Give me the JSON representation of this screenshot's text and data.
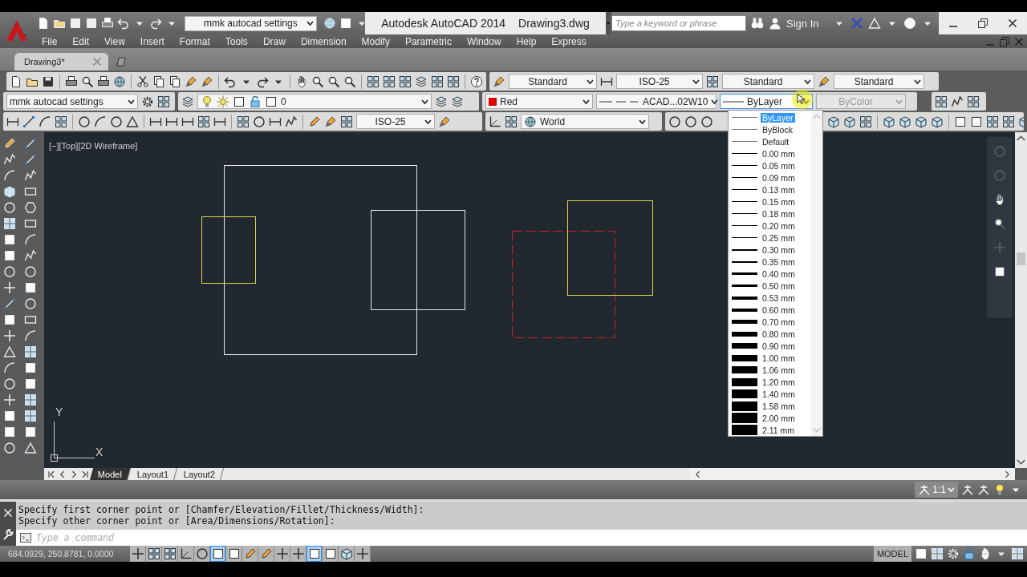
{
  "title_bar": {
    "workspace": "mmk autocad settings",
    "title": "Autodesk AutoCAD 2014",
    "document": "Drawing3.dwg",
    "search": {
      "placeholder": "Type a keyword or phrase"
    },
    "sign_in": "Sign In"
  },
  "menu": [
    "File",
    "Edit",
    "View",
    "Insert",
    "Format",
    "Tools",
    "Draw",
    "Dimension",
    "Modify",
    "Parametric",
    "Window",
    "Help",
    "Express"
  ],
  "document_tabs": [
    {
      "label": "Drawing3*",
      "selected": true
    }
  ],
  "styles_toolbar": {
    "text_style": "Standard",
    "dimension_style": "ISO-25",
    "table_style": "Standard",
    "multileader_style": "Standard"
  },
  "workspaces_toolbar": {
    "workspace": "mmk autocad settings"
  },
  "layers_toolbar": {
    "layer": "0"
  },
  "properties_toolbar": {
    "color": {
      "label": "Red",
      "color": "#e00000"
    },
    "linetype": "ACAD...02W10",
    "lineweight": {
      "label": "ByLayer",
      "expanded": true
    },
    "plot_style": {
      "label": "ByColor",
      "disabled": true
    }
  },
  "dimension_toolbar": {
    "dimension_style": "ISO-25"
  },
  "ucs_toolbar": {
    "ucs": "World"
  },
  "lineweight_list": [
    {
      "label": "ByLayer",
      "selected": true
    },
    {
      "label": "ByBlock",
      "selected": false
    },
    {
      "label": "Default",
      "selected": false
    },
    {
      "label": "0.00 mm",
      "selected": false
    },
    {
      "label": "0.05 mm",
      "selected": false
    },
    {
      "label": "0.09 mm",
      "selected": false
    },
    {
      "label": "0.13 mm",
      "selected": false
    },
    {
      "label": "0.15 mm",
      "selected": false
    },
    {
      "label": "0.18 mm",
      "selected": false
    },
    {
      "label": "0.20 mm",
      "selected": false
    },
    {
      "label": "0.25 mm",
      "selected": false
    },
    {
      "label": "0.30 mm",
      "selected": false
    },
    {
      "label": "0.35 mm",
      "selected": false
    },
    {
      "label": "0.40 mm",
      "selected": false
    },
    {
      "label": "0.50 mm",
      "selected": false
    },
    {
      "label": "0.53 mm",
      "selected": false
    },
    {
      "label": "0.60 mm",
      "selected": false
    },
    {
      "label": "0.70 mm",
      "selected": false
    },
    {
      "label": "0.80 mm",
      "selected": false
    },
    {
      "label": "0.90 mm",
      "selected": false
    },
    {
      "label": "1.00 mm",
      "selected": false
    },
    {
      "label": "1.06 mm",
      "selected": false
    },
    {
      "label": "1.20 mm",
      "selected": false
    },
    {
      "label": "1.40 mm",
      "selected": false
    },
    {
      "label": "1.58 mm",
      "selected": false
    },
    {
      "label": "2.00 mm",
      "selected": false
    },
    {
      "label": "2.11 mm",
      "selected": false
    }
  ],
  "viewport": {
    "label": "[−][Top][2D Wireframe]"
  },
  "ucs_icon": {
    "x_label": "X",
    "y_label": "Y"
  },
  "layout_tabs": [
    {
      "label": "Model",
      "selected": true
    },
    {
      "label": "Layout1",
      "selected": false
    },
    {
      "label": "Layout2",
      "selected": false
    }
  ],
  "annotation_scale": "1:1",
  "command_history": [
    "Specify first corner point or [Chamfer/Elevation/Fillet/Thickness/Width]:",
    "Specify other corner point or [Area/Dimensions/Rotation]:"
  ],
  "command_line": {
    "placeholder": "Type a command"
  },
  "status_bar": {
    "coordinates": "684.0929, 250.8781, 0.0000",
    "toggles": [
      {
        "on": false
      },
      {
        "on": false
      },
      {
        "on": false
      },
      {
        "on": false
      },
      {
        "on": false
      },
      {
        "on": true
      },
      {
        "on": false
      },
      {
        "on": false
      },
      {
        "on": false
      },
      {
        "on": false
      },
      {
        "on": false
      },
      {
        "on": true
      },
      {
        "on": false
      },
      {
        "on": false
      },
      {
        "on": false
      }
    ],
    "space": "MODEL"
  }
}
